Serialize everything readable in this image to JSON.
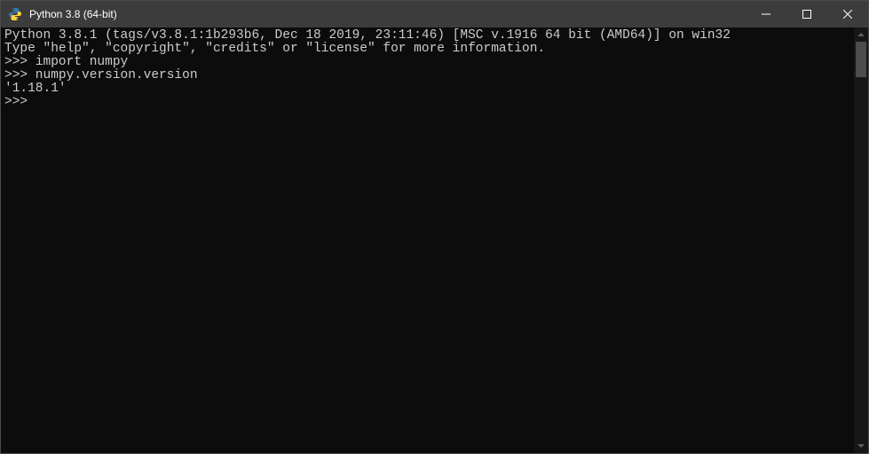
{
  "window": {
    "title": "Python 3.8 (64-bit)"
  },
  "terminal": {
    "lines": [
      "Python 3.8.1 (tags/v3.8.1:1b293b6, Dec 18 2019, 23:11:46) [MSC v.1916 64 bit (AMD64)] on win32",
      "Type \"help\", \"copyright\", \"credits\" or \"license\" for more information.",
      ">>> import numpy",
      ">>> numpy.version.version",
      "'1.18.1'",
      ">>> "
    ]
  }
}
